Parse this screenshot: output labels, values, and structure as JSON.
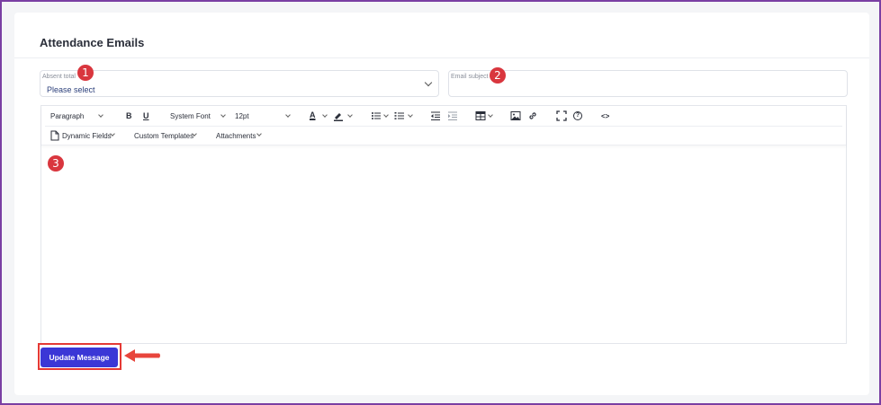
{
  "card": {
    "title": "Attendance Emails"
  },
  "absent_field": {
    "label": "Absent total",
    "value": "Please select"
  },
  "subject_field": {
    "label": "Email subject",
    "value": ""
  },
  "toolbar": {
    "block_format": "Paragraph",
    "bold": "B",
    "underline": "U",
    "font_family": "System Font",
    "font_size": "12pt",
    "text_color": "A",
    "code": "<>",
    "help": "?",
    "dynamic_fields": "Dynamic Fields",
    "custom_templates": "Custom Templates",
    "attachments": "Attachments"
  },
  "badges": [
    "1",
    "2",
    "3"
  ],
  "update_button": {
    "label": "Update Message"
  },
  "colors": {
    "accent": "#3b37d6",
    "badge": "#d9363e",
    "highlight": "#e53935",
    "frame": "#7a3fa3"
  }
}
